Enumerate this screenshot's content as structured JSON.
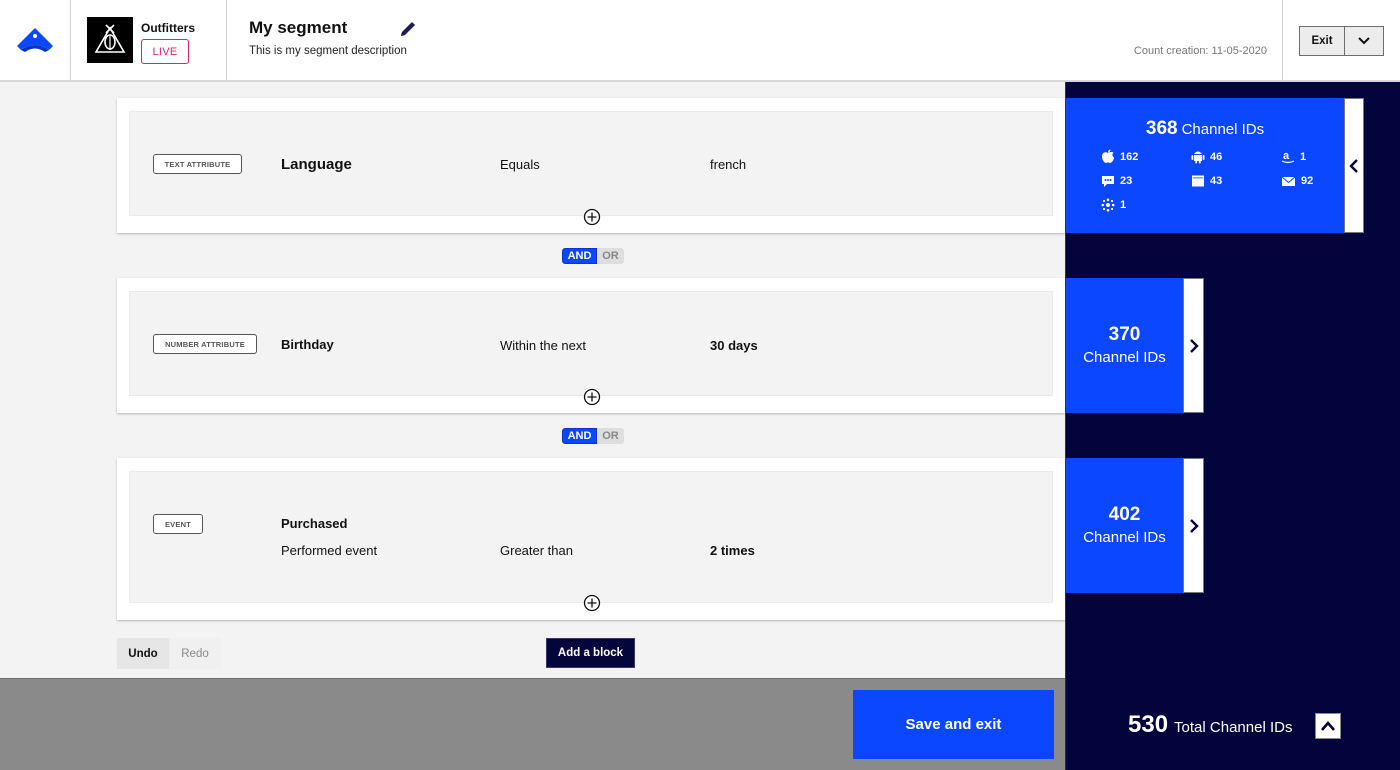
{
  "header": {
    "brand_name": "Outfitters",
    "status_badge": "LIVE",
    "segment_title": "My segment",
    "segment_description": "This is my segment description",
    "count_creation": "Count creation: 11-05-2020",
    "exit_label": "Exit"
  },
  "blocks": [
    {
      "type_tag": "TEXT ATTRIBUTE",
      "name": "Language",
      "operator": "Equals",
      "value": "french"
    },
    {
      "type_tag": "NUMBER ATTRIBUTE",
      "name": "Birthday",
      "operator": "Within the next",
      "value": "30 days"
    },
    {
      "type_tag": "EVENT",
      "name": "Purchased",
      "subject": "Performed event",
      "operator": "Greater than",
      "value": "2 times"
    }
  ],
  "connectors": [
    {
      "and": "AND",
      "or": "OR",
      "selected": "AND"
    },
    {
      "and": "AND",
      "or": "OR",
      "selected": "AND"
    }
  ],
  "actions": {
    "undo": "Undo",
    "redo": "Redo",
    "add_block": "Add a block",
    "save_exit": "Save and exit"
  },
  "counts": {
    "cards": [
      {
        "value": "368",
        "label": "Channel IDs",
        "expanded": true,
        "channels": [
          {
            "icon": "apple-icon",
            "count": "162"
          },
          {
            "icon": "android-icon",
            "count": "46"
          },
          {
            "icon": "amazon-icon",
            "count": "1"
          },
          {
            "icon": "sms-icon",
            "count": "23"
          },
          {
            "icon": "web-browser-icon",
            "count": "43"
          },
          {
            "icon": "email-icon",
            "count": "92"
          },
          {
            "icon": "open-channel-icon",
            "count": "1"
          }
        ]
      },
      {
        "value": "370",
        "label": "Channel IDs",
        "expanded": false
      },
      {
        "value": "402",
        "label": "Channel IDs",
        "expanded": false
      }
    ],
    "total_value": "530",
    "total_label": "Total Channel IDs"
  },
  "colors": {
    "accent_blue": "#0a47ff",
    "navy": "#04043d",
    "live_red": "#e0245e"
  }
}
